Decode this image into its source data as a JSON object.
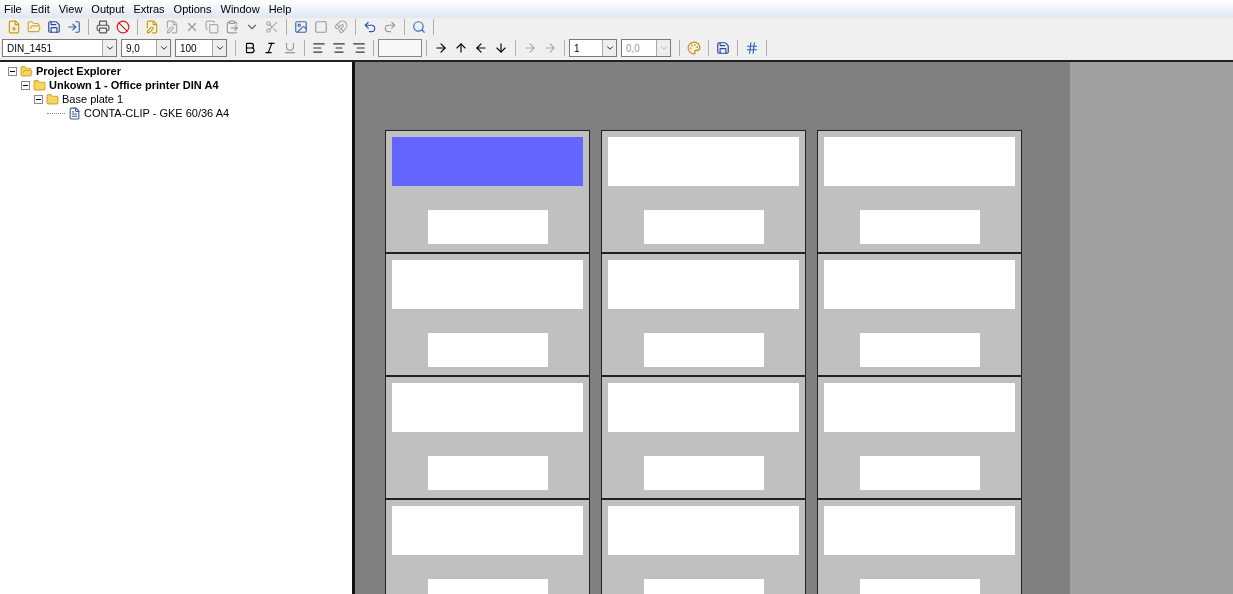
{
  "menu": [
    "File",
    "Edit",
    "View",
    "Output",
    "Extras",
    "Options",
    "Window",
    "Help"
  ],
  "format_bar": {
    "font": "DIN_1451",
    "size": "9,0",
    "zoom": "100",
    "step": "1",
    "offset": {
      "value": "0,0",
      "disabled": true
    }
  },
  "tree": [
    {
      "label": "Project Explorer",
      "kind": "root",
      "expanded": true,
      "children": [
        {
          "label": "Unkown 1 - Office printer DIN A4",
          "kind": "folder",
          "expanded": true,
          "children": [
            {
              "label": "Base plate 1",
              "kind": "folder",
              "expanded": true,
              "children": [
                {
                  "label": "CONTA-CLIP -  GKE 60/36 A4",
                  "kind": "document"
                }
              ]
            }
          ]
        }
      ]
    }
  ],
  "labels": [
    {
      "selected": true
    },
    {
      "selected": false
    },
    {
      "selected": false
    },
    {
      "selected": false
    },
    {
      "selected": false
    },
    {
      "selected": false
    },
    {
      "selected": false
    },
    {
      "selected": false
    },
    {
      "selected": false
    },
    {
      "selected": false
    },
    {
      "selected": false
    },
    {
      "selected": false
    }
  ]
}
